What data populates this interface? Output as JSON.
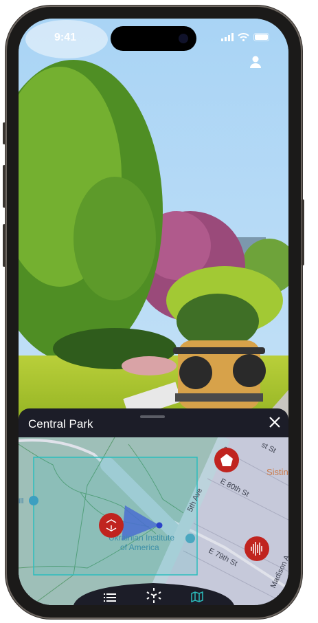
{
  "status_bar": {
    "time": "9:41"
  },
  "sheet": {
    "title": "Central Park"
  },
  "map": {
    "labels": {
      "left_poi": "ill",
      "institute_line1": "Ukrainian Institute",
      "institute_line2": "of America",
      "fifth_ave": "5th Ave",
      "fifth_ave_top": "Ave",
      "e80": "E 80th St",
      "e79": "E 79th St",
      "e81": "st St",
      "madison": "Madison A",
      "sistine": "Sistin"
    },
    "markers": [
      {
        "icon": "ar-cube-icon"
      },
      {
        "icon": "pentagon-icon"
      },
      {
        "icon": "sound-wave-icon"
      }
    ],
    "colors": {
      "marker": "#c0241f",
      "park": "#9ebfb8",
      "selection": "#2bbdbd",
      "user": "#2c43c8",
      "cone": "#4a6fd0"
    }
  },
  "nav": {
    "items": [
      {
        "icon": "list-icon"
      },
      {
        "icon": "ar-cube-icon"
      },
      {
        "icon": "map-icon",
        "active": true
      }
    ],
    "active_color": "#2bbdbd"
  }
}
